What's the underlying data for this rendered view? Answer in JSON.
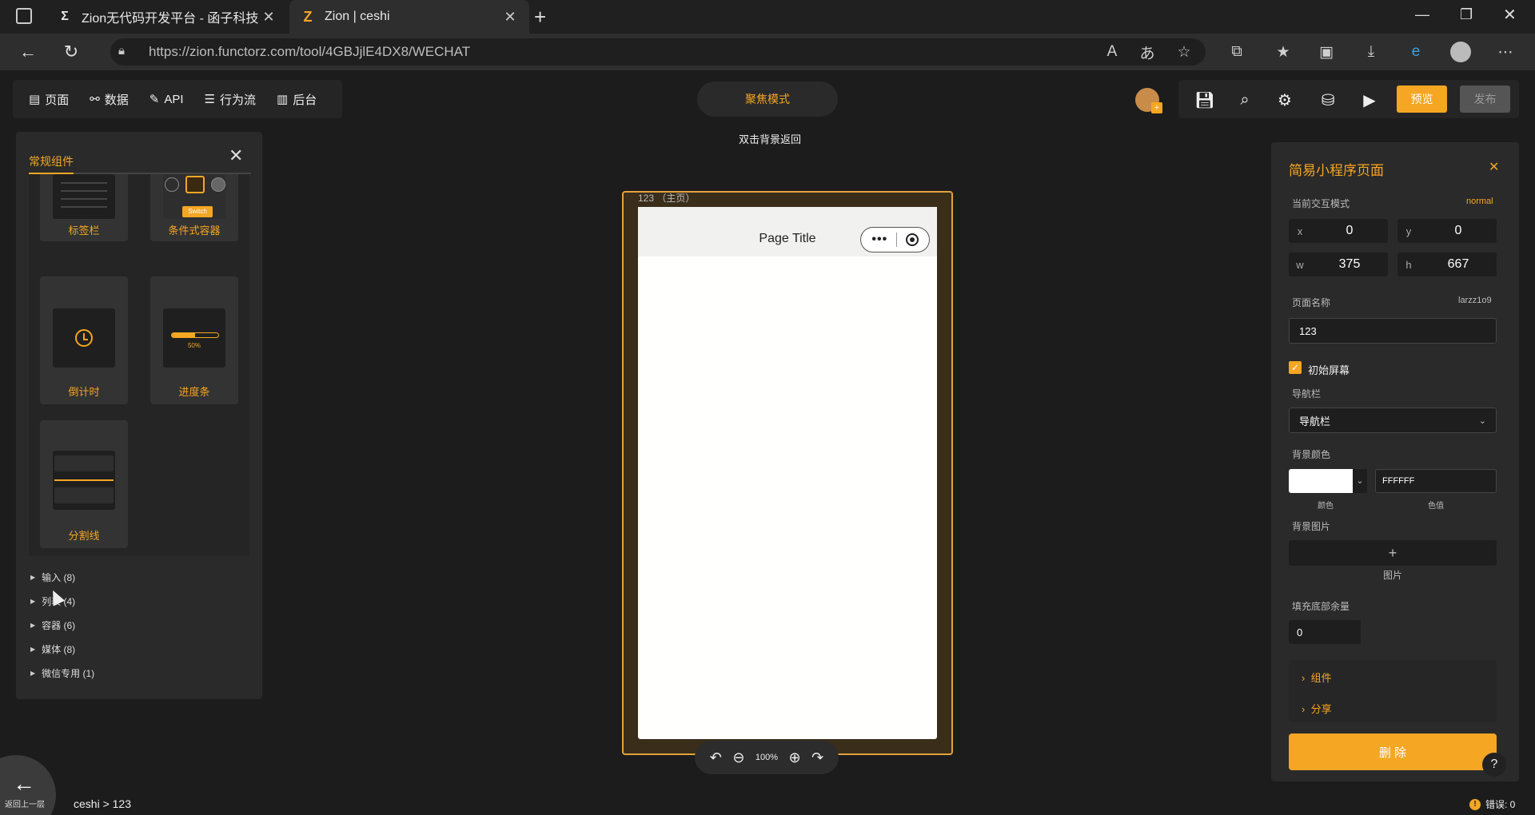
{
  "browser": {
    "tabs": [
      {
        "title": "Zion无代码开发平台 - 函子科技",
        "icon": "sigma-icon"
      },
      {
        "title": "Zion | ceshi",
        "icon": "zion-logo-icon"
      }
    ],
    "url": "https://zion.functorz.com/tool/4GBJjlE4DX8/WECHAT"
  },
  "toolbar": {
    "nav": [
      {
        "label": "页面",
        "icon": "page-icon"
      },
      {
        "label": "数据",
        "icon": "data-icon"
      },
      {
        "label": "API",
        "icon": "api-icon"
      },
      {
        "label": "行为流",
        "icon": "flow-icon"
      },
      {
        "label": "后台",
        "icon": "backend-icon"
      }
    ],
    "focus_mode": "聚焦模式",
    "hint": "双击背景返回",
    "preview": "预览",
    "publish": "发布"
  },
  "left_panel": {
    "title": "常规组件",
    "components": [
      {
        "label": "标签栏",
        "icon": "tabbar-icon"
      },
      {
        "label": "条件式容器",
        "icon": "switch-container-icon",
        "thumb_text": "Switch"
      },
      {
        "label": "倒计时",
        "icon": "alarm-clock-icon"
      },
      {
        "label": "进度条",
        "icon": "progress-bar-icon",
        "thumb_text": "50%",
        "progress": 0.5
      },
      {
        "label": "分割线",
        "icon": "divider-icon"
      }
    ],
    "categories": [
      {
        "label": "输入 (8)"
      },
      {
        "label": "列表 (4)"
      },
      {
        "label": "容器 (6)"
      },
      {
        "label": "媒体 (8)"
      },
      {
        "label": "微信专用 (1)"
      }
    ]
  },
  "canvas": {
    "page_label": "123 （主页）",
    "page_title": "Page Title",
    "zoom": "100%"
  },
  "right_panel": {
    "title": "简易小程序页面",
    "interaction_mode_label": "当前交互模式",
    "interaction_mode_value": "normal",
    "x_label": "x",
    "x": "0",
    "y_label": "y",
    "y": "0",
    "w_label": "w",
    "w": "375",
    "h_label": "h",
    "h": "667",
    "page_name_label": "页面名称",
    "page_id": "larzz1o9",
    "page_name_value": "123",
    "initial_screen": "初始屏幕",
    "navbar_label": "导航栏",
    "navbar_value": "导航栏",
    "bg_color_label": "背景颜色",
    "bg_color_hex": "FFFFFF",
    "color_caption": "颜色",
    "value_caption": "色值",
    "bg_image_label": "背景图片",
    "image_caption": "图片",
    "fill_bottom_label": "填充底部余量",
    "fill_bottom_value": "0",
    "sections": [
      {
        "label": "组件"
      },
      {
        "label": "分享"
      }
    ],
    "delete": "删 除"
  },
  "status": {
    "back_label": "返回上一层",
    "breadcrumb": "ceshi > 123",
    "errors": "错误: 0"
  },
  "colors": {
    "accent": "#f5a623",
    "bg": "#1c1c1c",
    "panel": "#2a2a2a"
  }
}
